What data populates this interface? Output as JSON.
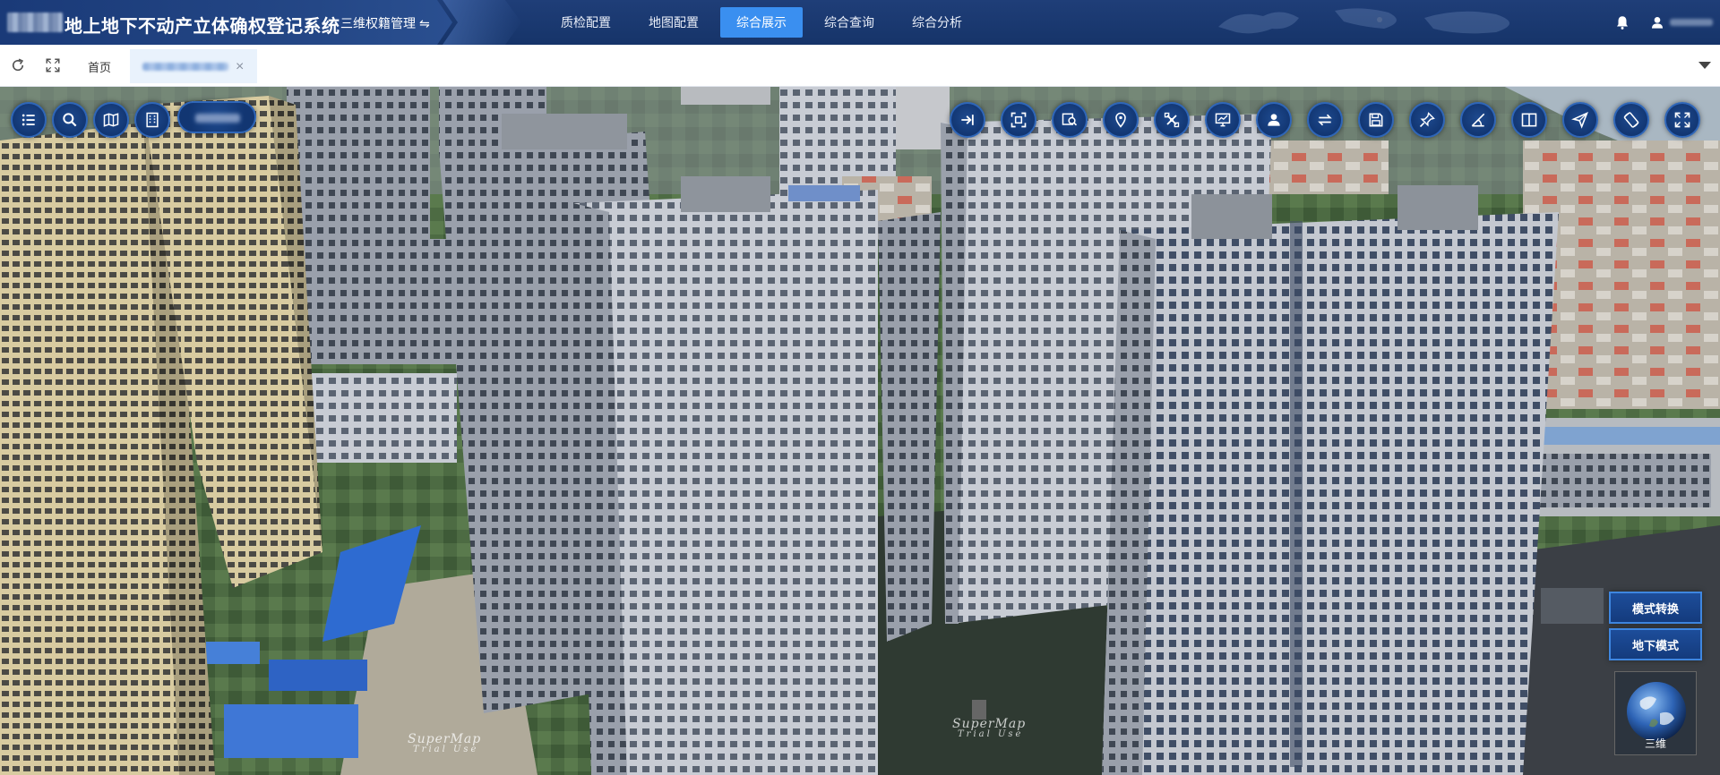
{
  "header": {
    "title": "地上地下不动产立体确权登记系统",
    "module": "三维权籍管理",
    "module_switch_glyph": "⇋",
    "nav": [
      "质检配置",
      "地图配置",
      "综合展示",
      "综合查询",
      "综合分析"
    ],
    "active_nav_index": 2
  },
  "tabs": {
    "home": "首页",
    "close_glyph": "×"
  },
  "left_toolbar": {
    "icons": [
      "layers-list-icon",
      "search-icon",
      "map-icon",
      "building-icon"
    ]
  },
  "right_toolbar": {
    "icons": [
      "collapse-right-icon",
      "frame-select-icon",
      "query-icon",
      "location-pin-icon",
      "satellite-icon",
      "monitor-chart-icon",
      "person-icon",
      "swap-arrows-icon",
      "save-icon",
      "pin-icon",
      "measure-icon",
      "split-screen-icon",
      "send-icon",
      "rotate-phone-icon",
      "fullscreen-icon"
    ]
  },
  "mode_panel": {
    "switch_label": "模式转换",
    "underground_label": "地下模式",
    "globe_label": "三维"
  },
  "watermark": {
    "line1": "SuperMap",
    "line2": "Trial Use"
  },
  "colors": {
    "header_bg": "#163469",
    "active_nav": "#3a8ff0",
    "tool_button": "#123672",
    "tool_border": "#2f66b8"
  }
}
